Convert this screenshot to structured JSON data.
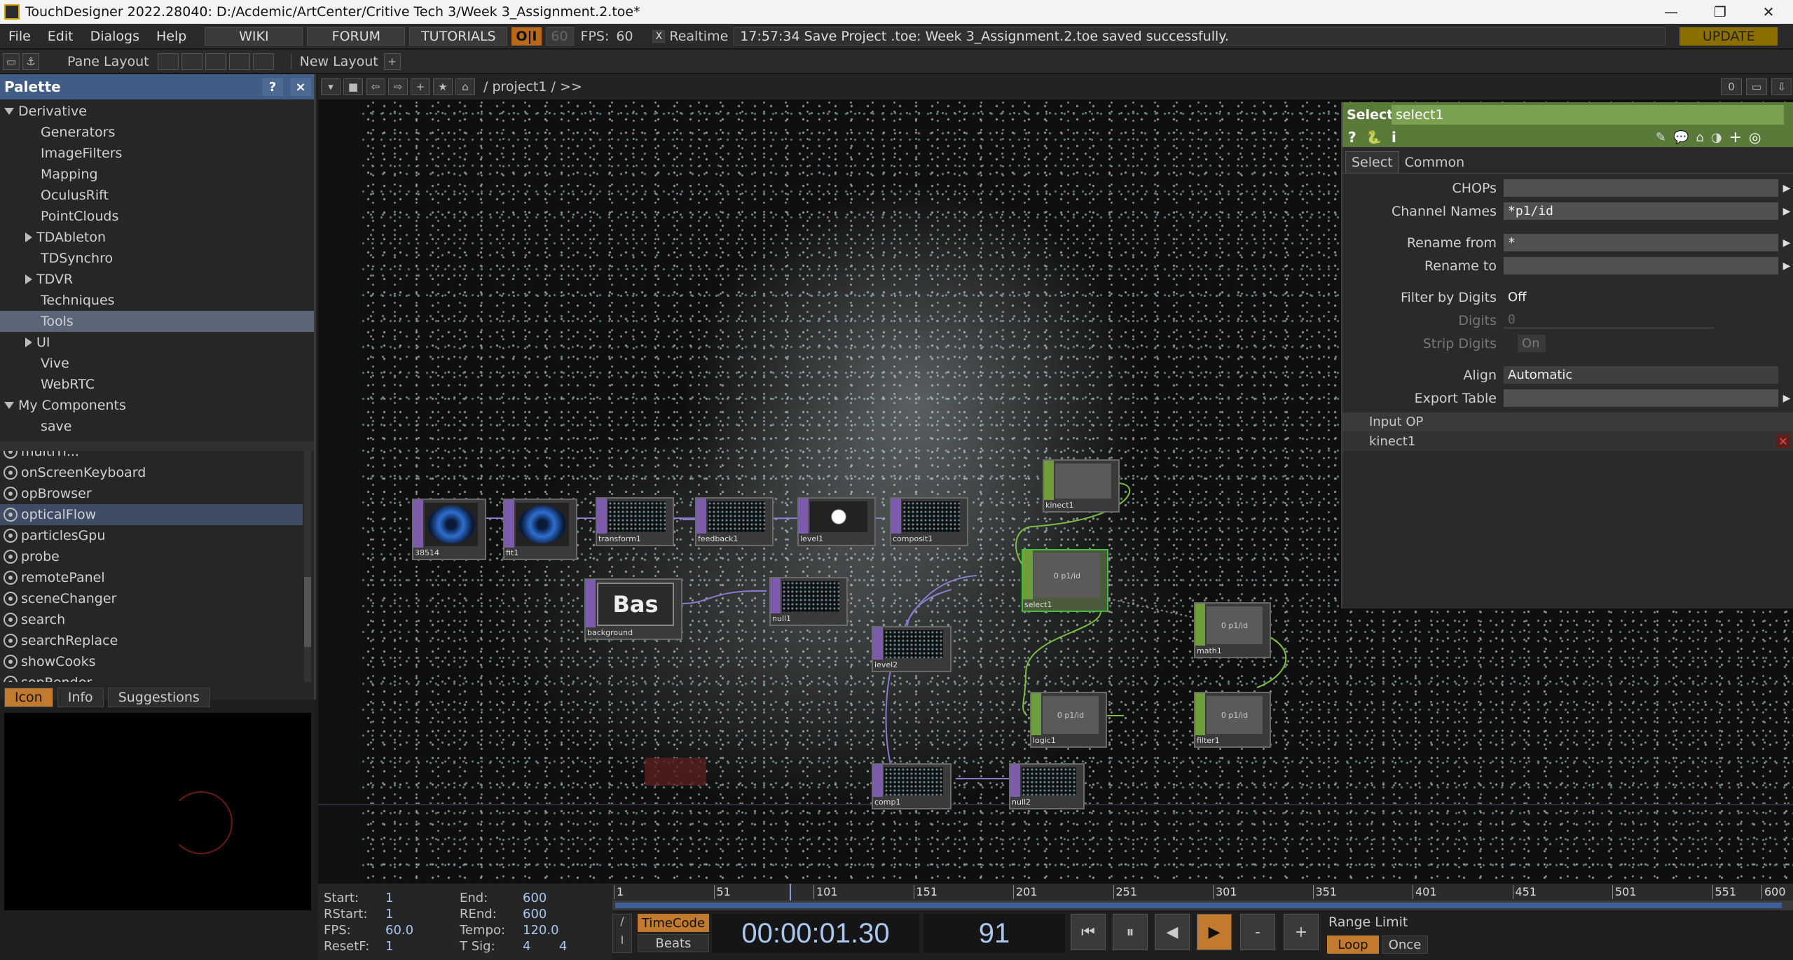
{
  "window": {
    "title": "TouchDesigner 2022.28040: D:/Acdemic/ArtCenter/Critive Tech 3/Week 3_Assignment.2.toe*"
  },
  "menu": {
    "items": [
      "File",
      "Edit",
      "Dialogs",
      "Help"
    ],
    "links": [
      "WIKI",
      "FORUM",
      "TUTORIALS"
    ],
    "oi": "O|I",
    "fps_target": "60",
    "fps_label": "FPS:",
    "fps_value": "60",
    "realtime_label": "Realtime",
    "realtime_check": "X",
    "status": "17:57:34 Save Project .toe: Week 3_Assignment.2.toe saved successfully.",
    "update": "UPDATE"
  },
  "toolbar2": {
    "pane_layout": "Pane Layout",
    "new_layout": "New Layout",
    "plus": "+"
  },
  "palette": {
    "title": "Palette",
    "help": "?",
    "close": "×",
    "tree": [
      {
        "label": "Derivative",
        "indent": 0,
        "arrow": "open"
      },
      {
        "label": "Generators",
        "indent": 2,
        "arrow": ""
      },
      {
        "label": "ImageFilters",
        "indent": 2,
        "arrow": ""
      },
      {
        "label": "Mapping",
        "indent": 2,
        "arrow": ""
      },
      {
        "label": "OculusRift",
        "indent": 2,
        "arrow": ""
      },
      {
        "label": "PointClouds",
        "indent": 2,
        "arrow": ""
      },
      {
        "label": "TDAbleton",
        "indent": 1,
        "arrow": "closed"
      },
      {
        "label": "TDSynchro",
        "indent": 2,
        "arrow": ""
      },
      {
        "label": "TDVR",
        "indent": 1,
        "arrow": "closed"
      },
      {
        "label": "Techniques",
        "indent": 2,
        "arrow": ""
      },
      {
        "label": "Tools",
        "indent": 2,
        "arrow": "",
        "selected": true
      },
      {
        "label": "UI",
        "indent": 1,
        "arrow": "closed"
      },
      {
        "label": "Vive",
        "indent": 2,
        "arrow": ""
      },
      {
        "label": "WebRTC",
        "indent": 2,
        "arrow": ""
      },
      {
        "label": "My Components",
        "indent": 0,
        "arrow": "open"
      },
      {
        "label": "save",
        "indent": 2,
        "arrow": ""
      }
    ],
    "tools": [
      {
        "label": "multiTi..."
      },
      {
        "label": "onScreenKeyboard"
      },
      {
        "label": "opBrowser"
      },
      {
        "label": "opticalFlow",
        "selected": true
      },
      {
        "label": "particlesGpu"
      },
      {
        "label": "probe"
      },
      {
        "label": "remotePanel"
      },
      {
        "label": "sceneChanger"
      },
      {
        "label": "search"
      },
      {
        "label": "searchReplace"
      },
      {
        "label": "showCooks"
      },
      {
        "label": "sopRender"
      }
    ],
    "tabs": [
      "Icon",
      "Info",
      "Suggestions"
    ]
  },
  "network": {
    "path": "/ project1 / >>",
    "counter": "0",
    "nodes": [
      {
        "name": "moviefilein",
        "type": "top",
        "label": "38514"
      },
      {
        "name": "filein2",
        "type": "top",
        "label": "fit1"
      },
      {
        "name": "transform",
        "type": "top",
        "label": "transform1"
      },
      {
        "name": "feedback",
        "type": "top",
        "label": "feedback1"
      },
      {
        "name": "level1",
        "type": "top",
        "label": "level1"
      },
      {
        "name": "composite",
        "type": "top",
        "label": "composit1"
      },
      {
        "name": "background",
        "type": "top",
        "label": "background",
        "text": "Bas"
      },
      {
        "name": "null1",
        "type": "top",
        "label": "null1"
      },
      {
        "name": "level2",
        "type": "top",
        "label": "level2"
      },
      {
        "name": "comp1",
        "type": "top",
        "label": "comp1"
      },
      {
        "name": "null2",
        "type": "top",
        "label": "null2"
      },
      {
        "name": "kinect1",
        "type": "chop",
        "label": "kinect1"
      },
      {
        "name": "select1",
        "type": "chop",
        "label": "select1",
        "text": "0 p1/id"
      },
      {
        "name": "math1",
        "type": "chop",
        "label": "math1",
        "text": "0 p1/id"
      },
      {
        "name": "logic1",
        "type": "chop",
        "label": "logic1",
        "text": "0 p1/id"
      },
      {
        "name": "filter1",
        "type": "chop",
        "label": "filter1",
        "text": "0 p1/id"
      }
    ]
  },
  "params": {
    "op_type": "Select",
    "op_name": "select1",
    "tabs": [
      "Select",
      "Common"
    ],
    "rows": [
      {
        "label": "CHOPs",
        "value": ""
      },
      {
        "label": "Channel Names",
        "value": "*p1/id"
      },
      {
        "label": "Rename from",
        "value": "*"
      },
      {
        "label": "Rename to",
        "value": ""
      },
      {
        "label": "Filter by Digits",
        "value": "Off"
      },
      {
        "label": "Digits",
        "value": "0"
      },
      {
        "label": "Strip Digits",
        "value": "On"
      },
      {
        "label": "Align",
        "value": "Automatic"
      },
      {
        "label": "Export Table",
        "value": ""
      }
    ],
    "input_header": "Input OP",
    "input_value": "kinect1"
  },
  "timeline": {
    "start_label": "Start:",
    "start": "1",
    "rstart_label": "RStart:",
    "rstart": "1",
    "fps_label": "FPS:",
    "fps": "60.0",
    "resetf_label": "ResetF:",
    "resetf": "1",
    "end_label": "End:",
    "end": "600",
    "rend_label": "REnd:",
    "rend": "600",
    "tempo_label": "Tempo:",
    "tempo": "120.0",
    "tsig_label": "T Sig:",
    "tsig_a": "4",
    "tsig_b": "4",
    "ruler": [
      "1",
      "51",
      "101",
      "151",
      "201",
      "251",
      "301",
      "351",
      "401",
      "451",
      "501",
      "551",
      "600"
    ],
    "timecode_label": "TimeCode",
    "beats_label": "Beats",
    "timecode": "00:00:01.30",
    "frame": "91",
    "range_limit": "Range Limit",
    "loop": "Loop",
    "once": "Once",
    "minus": "-",
    "plus": "+"
  }
}
